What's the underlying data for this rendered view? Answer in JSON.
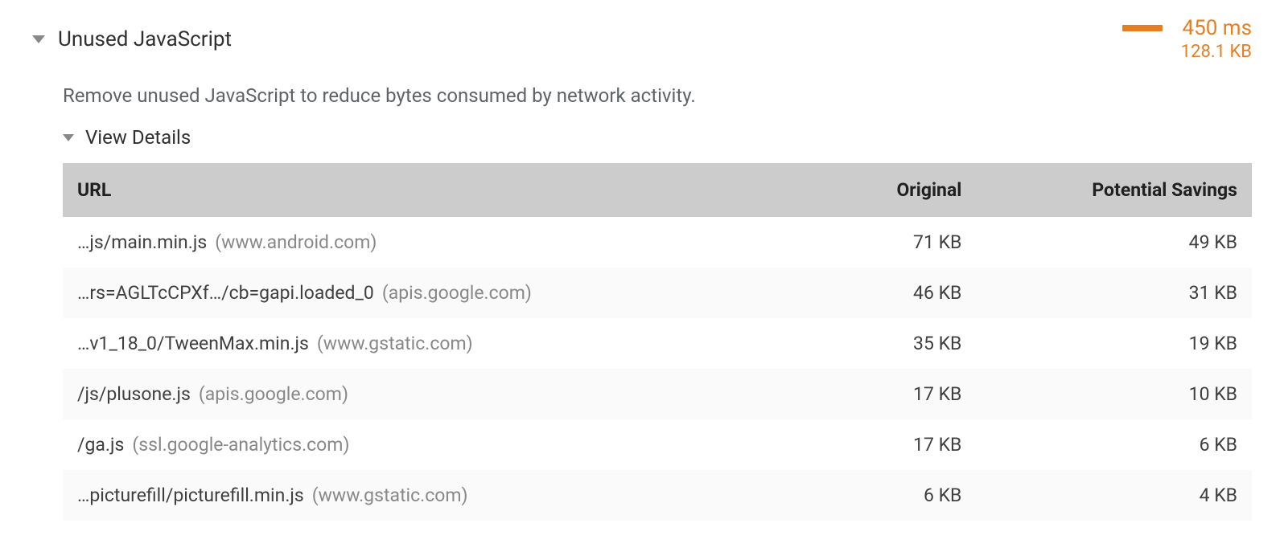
{
  "audit": {
    "title": "Unused JavaScript",
    "description": "Remove unused JavaScript to reduce bytes consumed by network activity.",
    "view_details_label": "View Details",
    "savings_time": "450 ms",
    "savings_size": "128.1 KB"
  },
  "table": {
    "headers": {
      "url": "URL",
      "original": "Original",
      "savings": "Potential Savings"
    },
    "rows": [
      {
        "path": "…js/main.min.js",
        "host": "(www.android.com)",
        "original": "71 KB",
        "savings": "49 KB"
      },
      {
        "path": "…rs=AGLTcCPXf…/cb=gapi.loaded_0",
        "host": "(apis.google.com)",
        "original": "46 KB",
        "savings": "31 KB"
      },
      {
        "path": "…v1_18_0/TweenMax.min.js",
        "host": "(www.gstatic.com)",
        "original": "35 KB",
        "savings": "19 KB"
      },
      {
        "path": "/js/plusone.js",
        "host": "(apis.google.com)",
        "original": "17 KB",
        "savings": "10 KB"
      },
      {
        "path": "/ga.js",
        "host": "(ssl.google-analytics.com)",
        "original": "17 KB",
        "savings": "6 KB"
      },
      {
        "path": "…picturefill/picturefill.min.js",
        "host": "(www.gstatic.com)",
        "original": "6 KB",
        "savings": "4 KB"
      }
    ]
  }
}
